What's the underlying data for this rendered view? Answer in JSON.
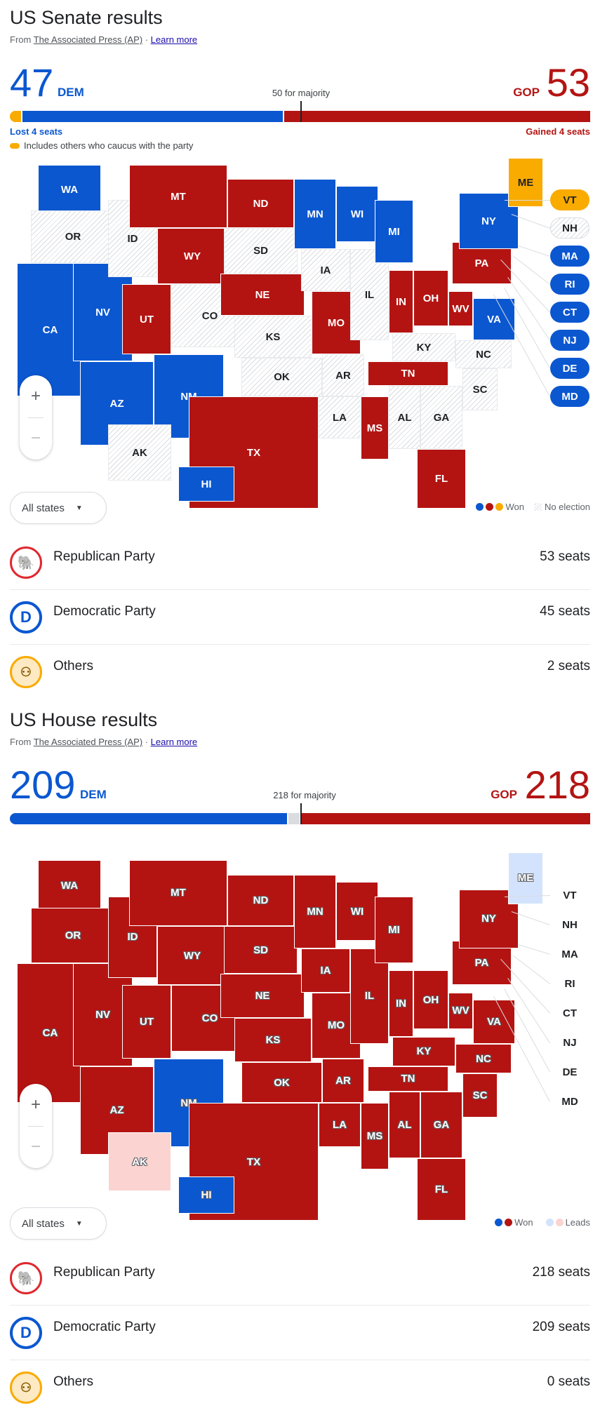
{
  "colors": {
    "dem": "#0b57d0",
    "gop": "#b31412",
    "other": "#f9ab00",
    "lead_dem": "#d3e3fd",
    "lead_gop": "#fbd3d1"
  },
  "senate": {
    "title": "US Senate results",
    "source_prefix": "From",
    "source_name": "The Associated Press (AP)",
    "source_sep": "·",
    "learn_more": "Learn more",
    "dem_count": "47",
    "dem_label": "DEM",
    "gop_count": "53",
    "gop_label": "GOP",
    "majority_label": "50 for majority",
    "seat_bar": {
      "total": 100,
      "majority": 50,
      "others_dem_caucus": 2,
      "dem": 45,
      "gop": 53
    },
    "dem_change": "Lost 4 seats",
    "gop_change": "Gained 4 seats",
    "others_note": "Includes others who caucus with the party",
    "states": {
      "WA": "d",
      "OR": "n",
      "CA": "d",
      "NV": "d",
      "ID": "n",
      "MT": "r",
      "WY": "r",
      "UT": "r",
      "AZ": "d",
      "CO": "n",
      "NM": "d",
      "ND": "r",
      "SD": "n",
      "NE": "r",
      "KS": "n",
      "OK": "n",
      "TX": "r",
      "MN": "d",
      "IA": "n",
      "MO": "r",
      "AR": "n",
      "LA": "n",
      "WI": "d",
      "IL": "n",
      "MS": "r",
      "MI": "d",
      "IN": "r",
      "KY": "n",
      "TN": "r",
      "AL": "n",
      "OH": "r",
      "WV": "r",
      "GA": "n",
      "FL": "r",
      "SC": "n",
      "NC": "n",
      "VA": "d",
      "PA": "r",
      "NY": "d",
      "ME": "o",
      "AK": "n",
      "HI": "d"
    },
    "callouts": [
      {
        "code": "VT",
        "status": "o"
      },
      {
        "code": "NH",
        "status": "n"
      },
      {
        "code": "MA",
        "status": "d"
      },
      {
        "code": "RI",
        "status": "d"
      },
      {
        "code": "CT",
        "status": "d"
      },
      {
        "code": "NJ",
        "status": "d"
      },
      {
        "code": "DE",
        "status": "d"
      },
      {
        "code": "MD",
        "status": "d"
      }
    ],
    "zoom_in": "+",
    "zoom_out": "−",
    "filter_label": "All states",
    "legend": {
      "won": "Won",
      "no_election": "No election"
    },
    "parties": [
      {
        "name": "Republican Party",
        "seats": "53 seats",
        "icon": "republican-elephant-icon"
      },
      {
        "name": "Democratic Party",
        "seats": "45 seats",
        "icon": "democratic-d-icon"
      },
      {
        "name": "Others",
        "seats": "2 seats",
        "icon": "others-people-icon"
      }
    ]
  },
  "house": {
    "title": "US House results",
    "source_prefix": "From",
    "source_name": "The Associated Press (AP)",
    "source_sep": "·",
    "learn_more": "Learn more",
    "dem_count": "209",
    "dem_label": "DEM",
    "gop_count": "218",
    "gop_label": "GOP",
    "majority_label": "218 for majority",
    "seat_bar": {
      "total": 435,
      "majority": 218,
      "dem": 209,
      "undecided": 8,
      "gop": 218
    },
    "states": {
      "WA": "r",
      "OR": "r",
      "CA": "r",
      "NV": "r",
      "ID": "r",
      "MT": "r",
      "WY": "r",
      "UT": "r",
      "AZ": "r",
      "CO": "r",
      "NM": "d",
      "ND": "r",
      "SD": "r",
      "NE": "r",
      "KS": "r",
      "OK": "r",
      "TX": "r",
      "MN": "r",
      "IA": "r",
      "MO": "r",
      "AR": "r",
      "LA": "r",
      "WI": "r",
      "IL": "r",
      "MS": "r",
      "MI": "r",
      "IN": "r",
      "KY": "r",
      "TN": "r",
      "AL": "r",
      "OH": "r",
      "WV": "r",
      "GA": "r",
      "FL": "r",
      "SC": "r",
      "NC": "r",
      "VA": "r",
      "PA": "r",
      "NY": "r",
      "ME": "ld",
      "AK": "lr",
      "HI": "d"
    },
    "callouts": [
      {
        "code": "VT",
        "status": "t"
      },
      {
        "code": "NH",
        "status": "t"
      },
      {
        "code": "MA",
        "status": "t"
      },
      {
        "code": "RI",
        "status": "t"
      },
      {
        "code": "CT",
        "status": "t"
      },
      {
        "code": "NJ",
        "status": "t"
      },
      {
        "code": "DE",
        "status": "t"
      },
      {
        "code": "MD",
        "status": "t"
      }
    ],
    "zoom_in": "+",
    "zoom_out": "−",
    "filter_label": "All states",
    "legend": {
      "won": "Won",
      "leads": "Leads"
    },
    "parties": [
      {
        "name": "Republican Party",
        "seats": "218 seats",
        "icon": "republican-elephant-icon"
      },
      {
        "name": "Democratic Party",
        "seats": "209 seats",
        "icon": "democratic-d-icon"
      },
      {
        "name": "Others",
        "seats": "0 seats",
        "icon": "others-people-icon"
      }
    ]
  }
}
